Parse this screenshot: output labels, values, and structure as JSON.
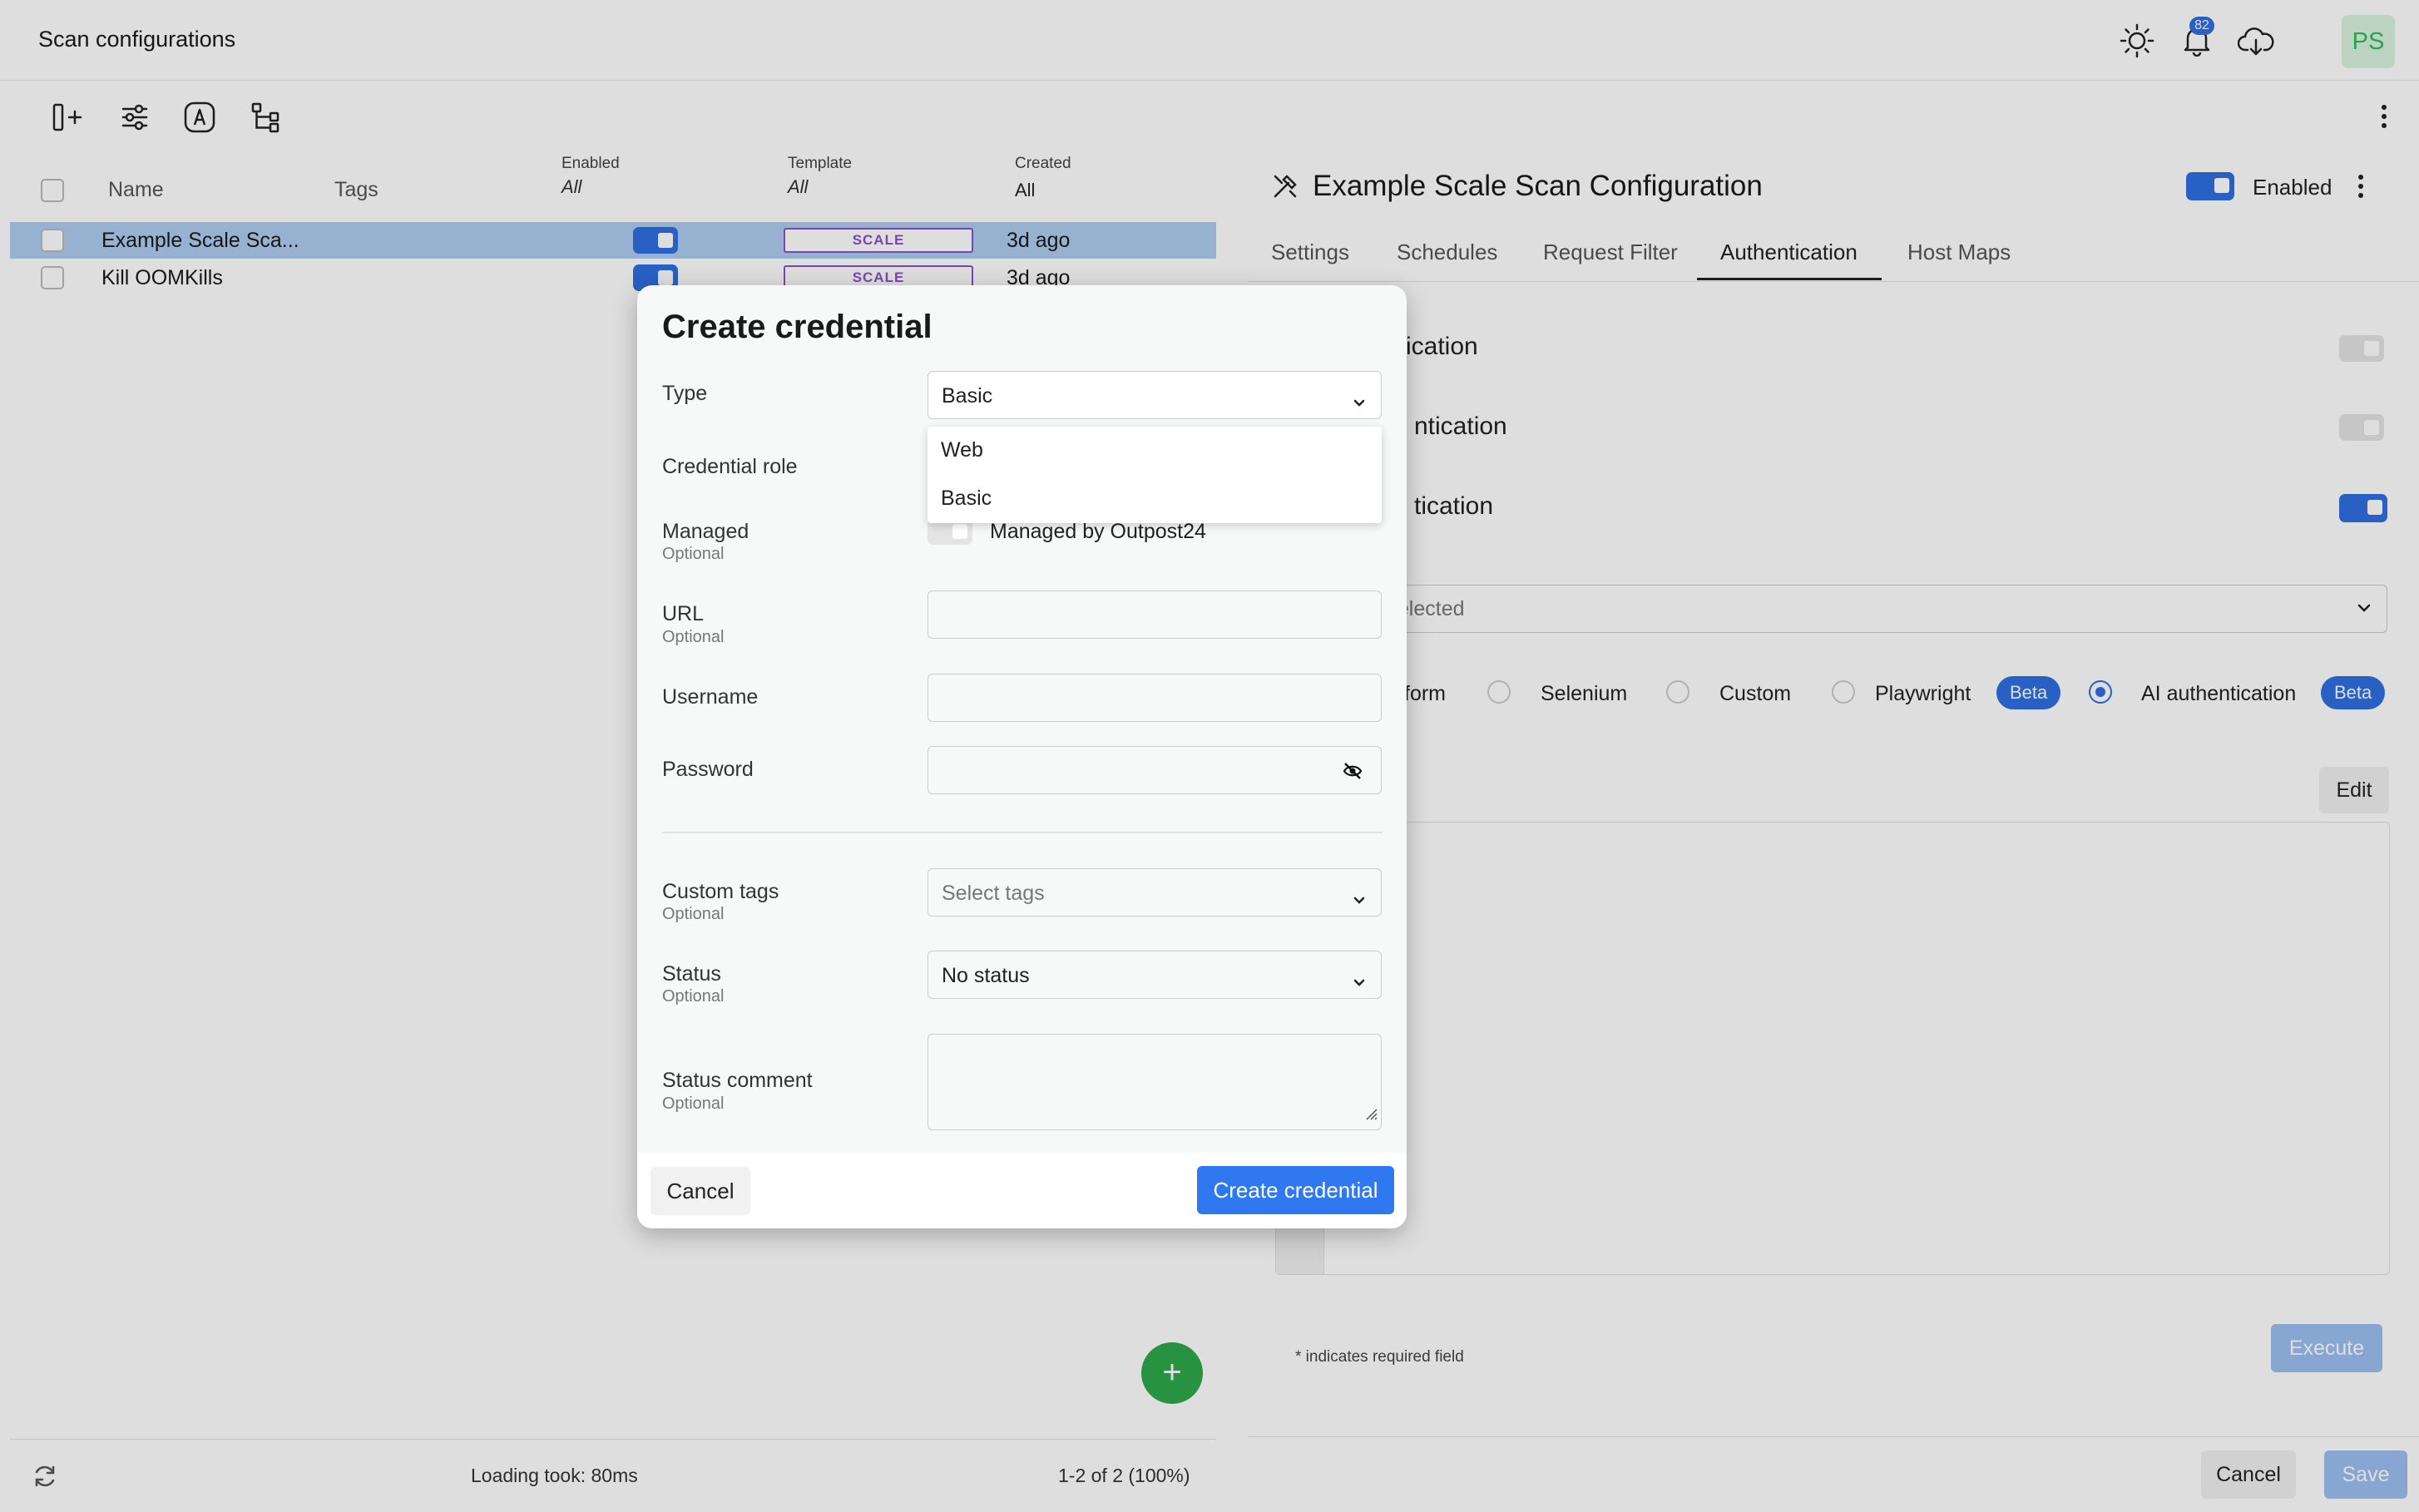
{
  "header": {
    "title": "Scan configurations",
    "notifications_count": "82",
    "avatar": "PS"
  },
  "toolbar": {
    "icons": [
      "add-column-icon",
      "sliders-icon",
      "at-sign-icon",
      "hierarchy-icon"
    ]
  },
  "table": {
    "columns": {
      "name": "Name",
      "tags": "Tags",
      "enabled_label": "Enabled",
      "enabled_value": "All",
      "template_label": "Template",
      "template_value": "All",
      "created_label": "Created",
      "created_value": "All"
    },
    "rows": [
      {
        "name": "Example Scale Sca...",
        "enabled": true,
        "template": "SCALE",
        "created": "3d ago",
        "selected": true
      },
      {
        "name": "Kill OOMKills",
        "enabled": true,
        "template": "SCALE",
        "created": "3d ago",
        "selected": false
      }
    ]
  },
  "footer": {
    "loading": "Loading took: 80ms",
    "pagination": "1-2 of 2 (100%)"
  },
  "details": {
    "title": "Example Scale Scan Configuration",
    "enabled_label": "Enabled",
    "tabs": [
      "Settings",
      "Schedules",
      "Request Filter",
      "Authentication",
      "Host Maps"
    ],
    "active_tab": "Authentication",
    "auth_rows": [
      "ication",
      "ntication",
      "tication"
    ],
    "credential_select": "al selected",
    "methods": {
      "form": "form",
      "selenium": "Selenium",
      "custom": "Custom",
      "playwright": "Playwright",
      "playwright_badge": "Beta",
      "ai": "AI authentication",
      "ai_badge": "Beta"
    },
    "edit_label": "Edit",
    "required_note": "* indicates required field",
    "execute_label": "Execute",
    "cancel_label": "Cancel",
    "save_label": "Save"
  },
  "modal": {
    "title": "Create credential",
    "type_label": "Type",
    "type_value": "Basic",
    "type_options": [
      "Web",
      "Basic"
    ],
    "role_label": "Credential role",
    "managed_label": "Managed",
    "managed_optional": "Optional",
    "managed_toggle_label": "Managed by Outpost24",
    "url_label": "URL",
    "url_optional": "Optional",
    "username_label": "Username",
    "password_label": "Password",
    "tags_label": "Custom tags",
    "tags_optional": "Optional",
    "tags_placeholder": "Select tags",
    "status_label": "Status",
    "status_optional": "Optional",
    "status_value": "No status",
    "comment_label": "Status comment",
    "comment_optional": "Optional",
    "cancel_label": "Cancel",
    "create_label": "Create credential"
  },
  "colors": {
    "accent": "#2f6fe0",
    "template_border": "#8a52c7",
    "fab": "#2da84a",
    "selected_row": "#aecdf0"
  }
}
